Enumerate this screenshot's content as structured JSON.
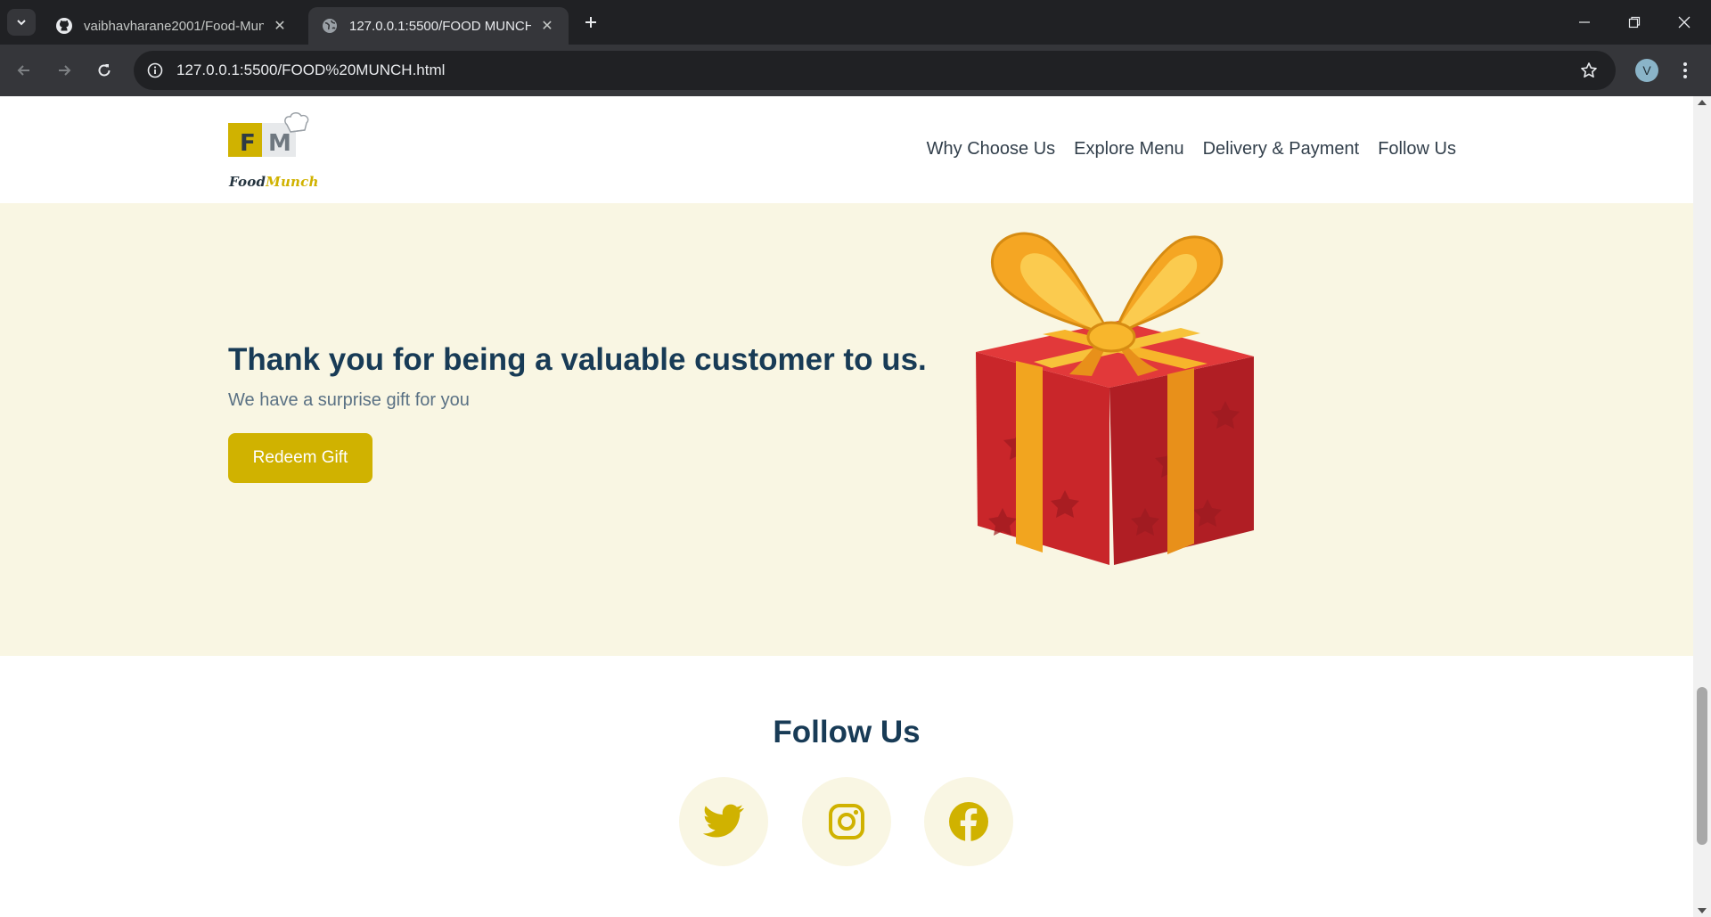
{
  "browser": {
    "tabs": [
      {
        "title": "vaibhavharane2001/Food-Munch",
        "favicon": "github-icon",
        "active": false
      },
      {
        "title": "127.0.0.1:5500/FOOD MUNCH.html",
        "favicon": "globe-icon",
        "active": true
      }
    ],
    "url": "127.0.0.1:5500/FOOD%20MUNCH.html",
    "profile_initial": "V"
  },
  "site": {
    "logo": {
      "letters": [
        "F",
        "M"
      ],
      "word_first": "Food",
      "word_second": "Munch"
    },
    "nav": [
      "Why Choose Us",
      "Explore Menu",
      "Delivery & Payment",
      "Follow Us"
    ],
    "thanks": {
      "heading": "Thank you for being a valuable customer to us.",
      "subtext": "We have a surprise gift for you",
      "button": "Redeem Gift",
      "image": "gift-box-icon"
    },
    "follow": {
      "heading": "Follow Us",
      "icons": [
        "twitter-icon",
        "instagram-icon",
        "facebook-icon"
      ]
    }
  },
  "colors": {
    "brand_yellow": "#d0b200",
    "heading_blue": "#183b56",
    "section_bg": "#f9f6e3",
    "gift_red": "#d42a2c",
    "ribbon_gold": "#f5a623"
  }
}
